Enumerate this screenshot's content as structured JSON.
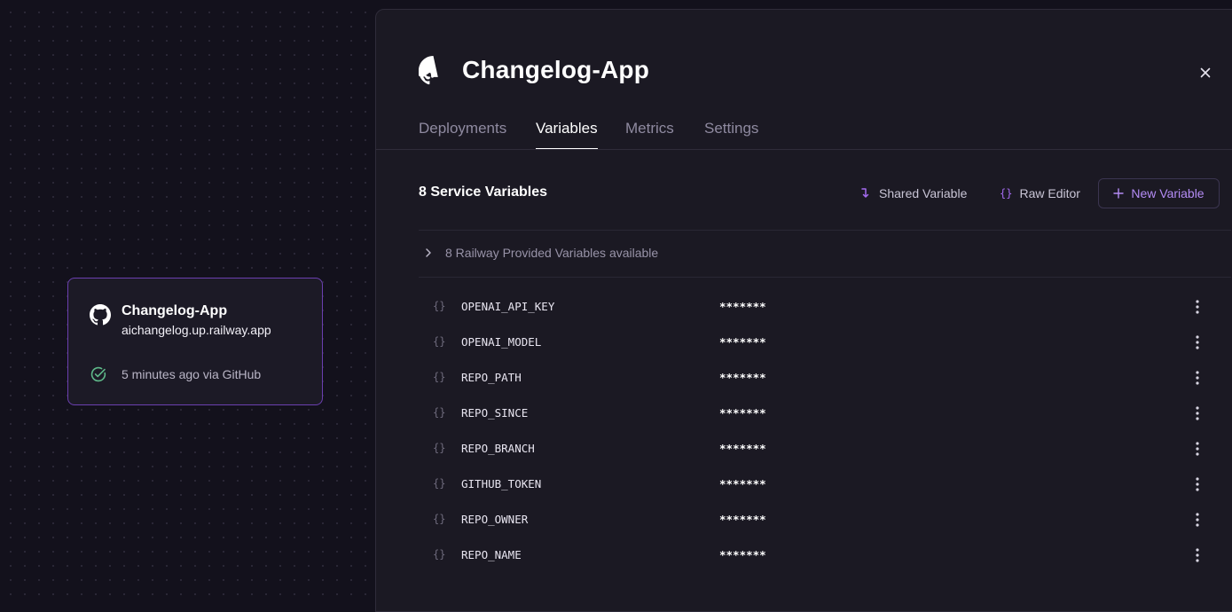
{
  "service_card": {
    "title": "Changelog-App",
    "url": "aichangelog.up.railway.app",
    "status": "5 minutes ago via GitHub",
    "icon": "github-icon",
    "status_icon": "check-circle-icon",
    "accent": "#6b3fb0",
    "status_color": "#5fb98a"
  },
  "panel": {
    "title": "Changelog-App",
    "icon": "github-icon",
    "close_icon": "close-icon",
    "tabs": [
      {
        "label": "Deployments"
      },
      {
        "label": "Variables",
        "active": true
      },
      {
        "label": "Metrics"
      },
      {
        "label": "Settings"
      }
    ]
  },
  "variables": {
    "heading": "8 Service Variables",
    "shared_label": "Shared Variable",
    "raw_label": "Raw Editor",
    "new_label": "New Variable",
    "accent": "#a46bf0",
    "provided_label": "8 Railway Provided Variables available",
    "brace": "{}",
    "rows": [
      {
        "name": "OPENAI_API_KEY",
        "value": "*******"
      },
      {
        "name": "OPENAI_MODEL",
        "value": "*******"
      },
      {
        "name": "REPO_PATH",
        "value": "*******"
      },
      {
        "name": "REPO_SINCE",
        "value": "*******"
      },
      {
        "name": "REPO_BRANCH",
        "value": "*******"
      },
      {
        "name": "GITHUB_TOKEN",
        "value": "*******"
      },
      {
        "name": "REPO_OWNER",
        "value": "*******"
      },
      {
        "name": "REPO_NAME",
        "value": "*******"
      }
    ]
  }
}
